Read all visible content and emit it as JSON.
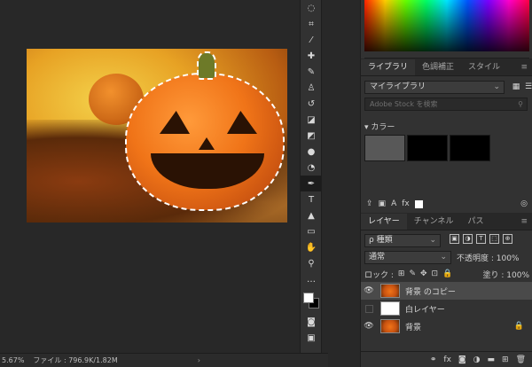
{
  "status": {
    "zoom": "5.67%",
    "file_info": "ファイル : 796.9K/1.82M",
    "arrow": "›"
  },
  "toolbar": {
    "tools": [
      {
        "name": "quick-selection-tool",
        "glyph": "◌"
      },
      {
        "name": "crop-tool",
        "glyph": "⌗"
      },
      {
        "name": "eyedropper-tool",
        "glyph": "⁄"
      },
      {
        "name": "healing-brush-tool",
        "glyph": "✚"
      },
      {
        "name": "brush-tool",
        "glyph": "✎"
      },
      {
        "name": "clone-stamp-tool",
        "glyph": "♙"
      },
      {
        "name": "history-brush-tool",
        "glyph": "↺"
      },
      {
        "name": "eraser-tool",
        "glyph": "◪"
      },
      {
        "name": "paint-bucket-tool",
        "glyph": "◩"
      },
      {
        "name": "blur-tool",
        "glyph": "●"
      },
      {
        "name": "dodge-tool",
        "glyph": "◔"
      },
      {
        "name": "pen-tool",
        "glyph": "✒"
      },
      {
        "name": "type-tool",
        "glyph": "T"
      },
      {
        "name": "path-selection-tool",
        "glyph": "▲"
      },
      {
        "name": "shape-tool",
        "glyph": "▭"
      },
      {
        "name": "hand-tool",
        "glyph": "✋"
      },
      {
        "name": "zoom-tool",
        "glyph": "⚲"
      },
      {
        "name": "more-tools",
        "glyph": "…"
      }
    ],
    "bottom": [
      {
        "name": "quick-mask-icon",
        "glyph": "◙"
      },
      {
        "name": "screen-mode-icon",
        "glyph": "▣"
      }
    ]
  },
  "libraries": {
    "tabs": [
      "ライブラリ",
      "色調補正",
      "スタイル"
    ],
    "tabs_menu": "≡",
    "library_name": "マイライブラリ",
    "search_placeholder": "Adobe Stock を検索",
    "colors_header": "▾ カラー",
    "swatches": [
      "#585858",
      "#000000",
      "#000000"
    ],
    "footer_fx": "fx"
  },
  "layers": {
    "tabs": [
      "レイヤー",
      "チャンネル",
      "パス"
    ],
    "tabs_menu": "≡",
    "filter_label": "ρ 種類",
    "filter_icons": [
      "▣",
      "◑",
      "T",
      "⬚",
      "⊕"
    ],
    "blend_mode": "通常",
    "opacity_label": "不透明度 : 100%",
    "lock_label": "ロック :",
    "lock_icons": [
      "⊞",
      "✎",
      "✥",
      "⊡",
      "🔒"
    ],
    "fill_label": "塗り : 100%",
    "items": [
      {
        "name": "背景 のコピー",
        "visible": true,
        "thumb": "pumpkin",
        "locked": false,
        "selected": true
      },
      {
        "name": "白レイヤー",
        "visible": false,
        "thumb": "white",
        "locked": false,
        "selected": false
      },
      {
        "name": "背景",
        "visible": true,
        "thumb": "pumpkin",
        "locked": true,
        "selected": false
      }
    ],
    "footer_fx": "fx"
  },
  "colors": {
    "panel_bg": "#323232",
    "canvas_bg": "#282828",
    "selected_layer": "#4a4a4a"
  }
}
